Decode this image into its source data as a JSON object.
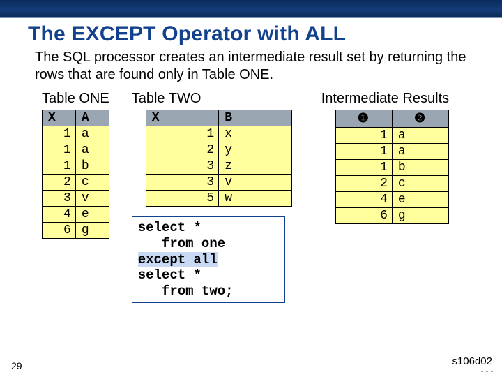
{
  "title": "The EXCEPT Operator with ALL",
  "description": "The SQL processor creates an intermediate result set by returning the rows that are found only in Table ONE.",
  "tables": {
    "one": {
      "label": "Table ONE",
      "headers": [
        "X",
        "A"
      ],
      "rows": [
        [
          "1",
          "a"
        ],
        [
          "1",
          "a"
        ],
        [
          "1",
          "b"
        ],
        [
          "2",
          "c"
        ],
        [
          "3",
          "v"
        ],
        [
          "4",
          "e"
        ],
        [
          "6",
          "g"
        ]
      ]
    },
    "two": {
      "label": "Table TWO",
      "headers": [
        "X",
        "B"
      ],
      "rows": [
        [
          "1",
          "x"
        ],
        [
          "2",
          "y"
        ],
        [
          "3",
          "z"
        ],
        [
          "3",
          "v"
        ],
        [
          "5",
          "w"
        ]
      ]
    },
    "results": {
      "label": "Intermediate Results",
      "headers": [
        "❶",
        "❷"
      ],
      "rows": [
        [
          "1",
          "a"
        ],
        [
          "1",
          "a"
        ],
        [
          "1",
          "b"
        ],
        [
          "2",
          "c"
        ],
        [
          "4",
          "e"
        ],
        [
          "6",
          "g"
        ]
      ]
    }
  },
  "sql": {
    "l1": "select *",
    "l2": "   from one",
    "l3": "except all",
    "l4": "select *",
    "l5": "   from two;"
  },
  "slide_number": "29",
  "ref_code": "s106d02",
  "dots": "..."
}
